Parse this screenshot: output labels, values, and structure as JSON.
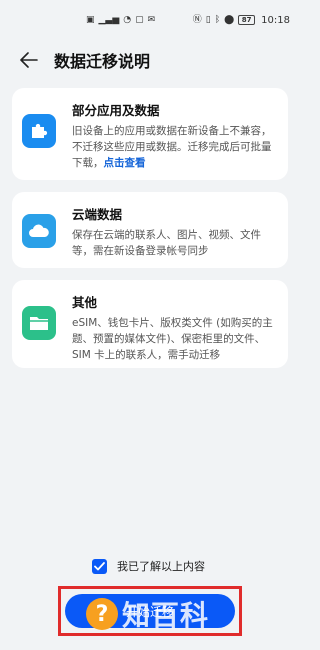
{
  "status_bar": {
    "left_icons": [
      "sim-icon",
      "signal-icon",
      "wifi-icon",
      "notification-icon",
      "message-icon"
    ],
    "right_icons": [
      "nfc-icon",
      "vibrate-icon",
      "bluetooth-icon",
      "location-icon"
    ],
    "battery": "87",
    "time": "10:18"
  },
  "header": {
    "title": "数据迁移说明"
  },
  "cards": [
    {
      "title": "部分应用及数据",
      "desc": "旧设备上的应用或数据在新设备上不兼容，不迁移这些应用或数据。迁移完成后可批量下载，",
      "link": "点击查看",
      "icon": "puzzle-icon",
      "icon_color": "#1a8cf0"
    },
    {
      "title": "云端数据",
      "desc": "保存在云端的联系人、图片、视频、文件等，需在新设备登录帐号同步",
      "icon": "cloud-icon",
      "icon_color": "#2aa0e8"
    },
    {
      "title": "其他",
      "desc": "eSIM、钱包卡片、版权类文件 (如购买的主题、预置的媒体文件)、保密柜里的文件、SIM 卡上的联系人，需手动迁移",
      "icon": "folder-icon",
      "icon_color": "#2cc08a"
    }
  ],
  "agree": {
    "label": "我已了解以上内容",
    "checked": true
  },
  "start_button": {
    "label": "开始迁移"
  },
  "watermark": {
    "text": "知百科"
  },
  "colors": {
    "accent": "#0a59f7",
    "background": "#f1f3f5",
    "highlight_box": "#e02b2b"
  }
}
